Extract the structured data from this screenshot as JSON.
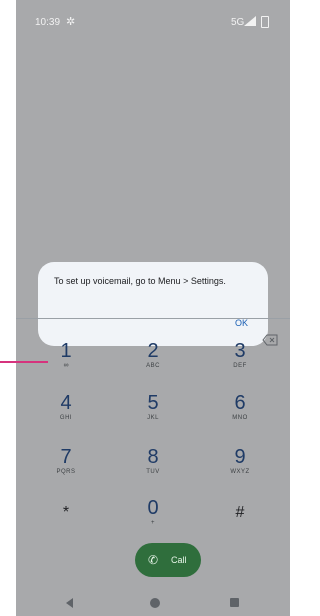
{
  "status_bar": {
    "time": "10:39",
    "network": "5G",
    "icons": [
      "gear-icon",
      "signal-icon",
      "battery-icon"
    ]
  },
  "dialog": {
    "message": "To set up voicemail, go to Menu > Settings.",
    "ok_label": "OK"
  },
  "dialpad": {
    "keys": [
      {
        "digit": "1",
        "letters": "∞"
      },
      {
        "digit": "2",
        "letters": "ABC"
      },
      {
        "digit": "3",
        "letters": "DEF"
      },
      {
        "digit": "4",
        "letters": "GHI"
      },
      {
        "digit": "5",
        "letters": "JKL"
      },
      {
        "digit": "6",
        "letters": "MNO"
      },
      {
        "digit": "7",
        "letters": "PQRS"
      },
      {
        "digit": "8",
        "letters": "TUV"
      },
      {
        "digit": "9",
        "letters": "WXYZ"
      },
      {
        "digit": "*",
        "letters": ""
      },
      {
        "digit": "0",
        "letters": "+"
      },
      {
        "digit": "#",
        "letters": ""
      }
    ],
    "call_label": "Call"
  },
  "colors": {
    "accent": "#1f3b66",
    "call_button": "#2f6e3c",
    "pointer": "#d6337d"
  }
}
